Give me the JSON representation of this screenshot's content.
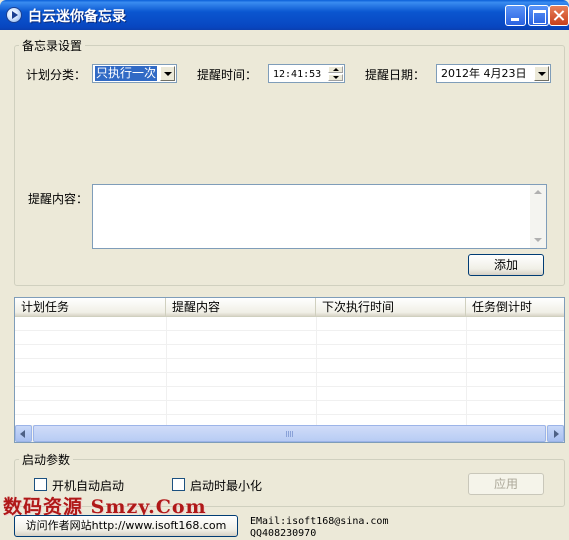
{
  "window": {
    "title": "白云迷你备忘录"
  },
  "settings": {
    "group_label": "备忘录设置",
    "category_label": "计划分类：",
    "category_value": "只执行一次",
    "time_label": "提醒时间：",
    "time_value": "12:41:53",
    "date_label": "提醒日期：",
    "date_value": "2012年 4月23日",
    "content_label": "提醒内容：",
    "content_value": "",
    "add_button": "添加"
  },
  "table": {
    "columns": [
      "计划任务",
      "提醒内容",
      "下次执行时间",
      "任务倒计时"
    ],
    "rows": []
  },
  "startup": {
    "group_label": "启动参数",
    "autostart_label": "开机自动启动",
    "autostart_checked": false,
    "minimize_label": "启动时最小化",
    "minimize_checked": false,
    "apply_button": "应用"
  },
  "footer": {
    "visit_button": "访问作者网站http://www.isoft168.com",
    "email": "EMail:isoft168@sina.com",
    "qq": "QQ408230970",
    "watermark": "数码资源 Smzy.Com"
  }
}
